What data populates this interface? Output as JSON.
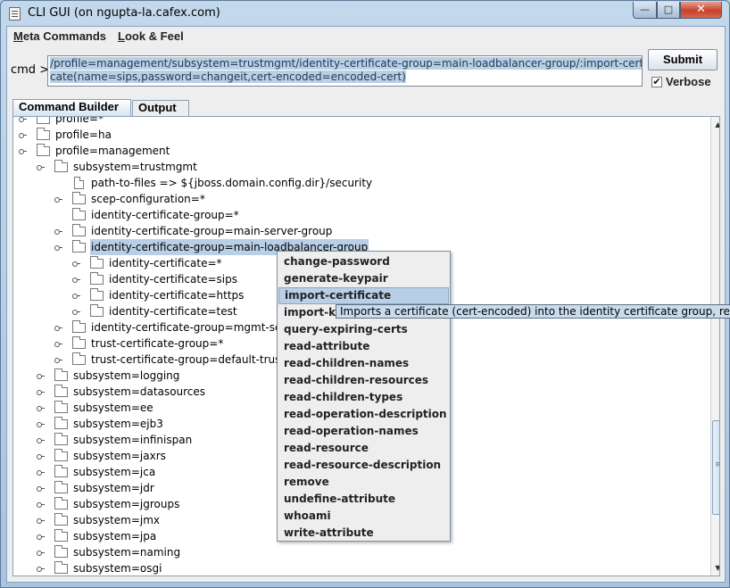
{
  "window": {
    "title": "CLI GUI (on ngupta-la.cafex.com)",
    "controls": {
      "minimize": "—",
      "maximize": "□",
      "close": "✕"
    }
  },
  "menubar": {
    "items": [
      {
        "underline": "M",
        "rest": "eta Commands"
      },
      {
        "underline": "L",
        "rest": "ook & Feel"
      }
    ]
  },
  "command": {
    "label": "cmd >",
    "value_line1": "/profile=management/subsystem=trustmgmt/identity-certificate-group=main-loadbalancer-group/:import-certifi",
    "value_line2": "cate(name=sips,password=changeit,cert-encoded=encoded-cert)",
    "submit_label": "Submit",
    "verbose_label": "Verbose",
    "verbose_checked": "✔"
  },
  "tabs": [
    {
      "label": "Command Builder",
      "active": true
    },
    {
      "label": "Output",
      "active": false
    }
  ],
  "tree": {
    "rows": [
      {
        "label": "profile=*",
        "depth": 0,
        "icon": "folder-icon",
        "toggle": true
      },
      {
        "label": "profile=ha",
        "depth": 0,
        "icon": "folder-icon",
        "toggle": true
      },
      {
        "label": "profile=management",
        "depth": 0,
        "icon": "folder-icon",
        "toggle": true
      },
      {
        "label": "subsystem=trustmgmt",
        "depth": 1,
        "icon": "folder-icon",
        "toggle": true
      },
      {
        "label": "path-to-files => ${jboss.domain.config.dir}/security",
        "depth": 2,
        "icon": "file-icon",
        "toggle": false
      },
      {
        "label": "scep-configuration=*",
        "depth": 2,
        "icon": "folder-icon",
        "toggle": true
      },
      {
        "label": "identity-certificate-group=*",
        "depth": 2,
        "icon": "folder-icon",
        "toggle": false
      },
      {
        "label": "identity-certificate-group=main-server-group",
        "depth": 2,
        "icon": "folder-icon",
        "toggle": true
      },
      {
        "label": "identity-certificate-group=main-loadbalancer-group",
        "depth": 2,
        "icon": "folder-icon",
        "toggle": true,
        "selected": true
      },
      {
        "label": "identity-certificate=*",
        "depth": 3,
        "icon": "folder-icon",
        "toggle": true
      },
      {
        "label": "identity-certificate=sips",
        "depth": 3,
        "icon": "folder-icon",
        "toggle": true
      },
      {
        "label": "identity-certificate=https",
        "depth": 3,
        "icon": "folder-icon",
        "toggle": true
      },
      {
        "label": "identity-certificate=test",
        "depth": 3,
        "icon": "folder-icon",
        "toggle": true
      },
      {
        "label": "identity-certificate-group=mgmt-server-group",
        "depth": 2,
        "icon": "folder-icon",
        "toggle": true
      },
      {
        "label": "trust-certificate-group=*",
        "depth": 2,
        "icon": "folder-icon",
        "toggle": true
      },
      {
        "label": "trust-certificate-group=default-trust",
        "depth": 2,
        "icon": "folder-icon",
        "toggle": true
      },
      {
        "label": "subsystem=logging",
        "depth": 1,
        "icon": "folder-icon",
        "toggle": true
      },
      {
        "label": "subsystem=datasources",
        "depth": 1,
        "icon": "folder-icon",
        "toggle": true
      },
      {
        "label": "subsystem=ee",
        "depth": 1,
        "icon": "folder-icon",
        "toggle": true
      },
      {
        "label": "subsystem=ejb3",
        "depth": 1,
        "icon": "folder-icon",
        "toggle": true
      },
      {
        "label": "subsystem=infinispan",
        "depth": 1,
        "icon": "folder-icon",
        "toggle": true
      },
      {
        "label": "subsystem=jaxrs",
        "depth": 1,
        "icon": "folder-icon",
        "toggle": true
      },
      {
        "label": "subsystem=jca",
        "depth": 1,
        "icon": "folder-icon",
        "toggle": true
      },
      {
        "label": "subsystem=jdr",
        "depth": 1,
        "icon": "folder-icon",
        "toggle": true
      },
      {
        "label": "subsystem=jgroups",
        "depth": 1,
        "icon": "folder-icon",
        "toggle": true
      },
      {
        "label": "subsystem=jmx",
        "depth": 1,
        "icon": "folder-icon",
        "toggle": true
      },
      {
        "label": "subsystem=jpa",
        "depth": 1,
        "icon": "folder-icon",
        "toggle": true
      },
      {
        "label": "subsystem=naming",
        "depth": 1,
        "icon": "folder-icon",
        "toggle": true
      },
      {
        "label": "subsystem=osgi",
        "depth": 1,
        "icon": "folder-icon",
        "toggle": true
      }
    ]
  },
  "scrollbar": {
    "up_arrow": "▲",
    "down_arrow": "▼"
  },
  "context_menu": {
    "items": [
      {
        "label": "change-password"
      },
      {
        "label": "generate-keypair"
      },
      {
        "label": "import-certificate",
        "highlighted": true
      },
      {
        "label": "import-k"
      },
      {
        "label": "query-expiring-certs"
      },
      {
        "label": "read-attribute"
      },
      {
        "label": "read-children-names"
      },
      {
        "label": "read-children-resources"
      },
      {
        "label": "read-children-types"
      },
      {
        "label": "read-operation-description"
      },
      {
        "label": "read-operation-names"
      },
      {
        "label": "read-resource"
      },
      {
        "label": "read-resource-description"
      },
      {
        "label": "remove"
      },
      {
        "label": "undefine-attribute"
      },
      {
        "label": "whoami"
      },
      {
        "label": "write-attribute"
      }
    ]
  },
  "tooltip": {
    "text": "Imports a certificate (cert-encoded) into the identity certificate group, refere"
  }
}
